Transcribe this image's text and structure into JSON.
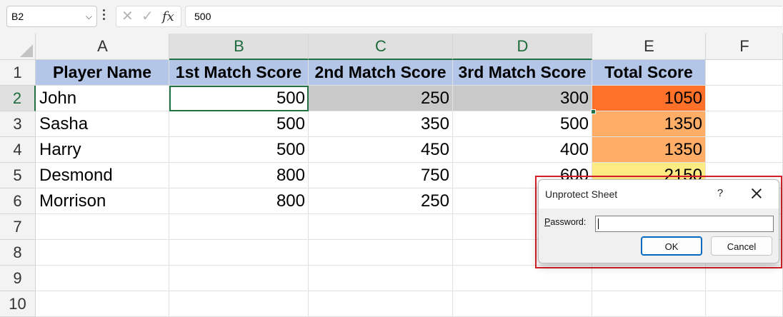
{
  "formula_bar": {
    "name_box": "B2",
    "cancel_symbol": "✕",
    "enter_symbol": "✓",
    "fx_label": "fx",
    "formula_value": "500"
  },
  "columns": [
    "A",
    "B",
    "C",
    "D",
    "E",
    "F"
  ],
  "rows": [
    "1",
    "2",
    "3",
    "4",
    "5",
    "6",
    "7",
    "8",
    "9",
    "10"
  ],
  "table": {
    "headers": [
      "Player Name",
      "1st Match Score",
      "2nd Match Score",
      "3rd Match Score",
      "Total Score"
    ],
    "data": [
      [
        "John",
        "500",
        "250",
        "300",
        "1050"
      ],
      [
        "Sasha",
        "500",
        "350",
        "500",
        "1350"
      ],
      [
        "Harry",
        "500",
        "450",
        "400",
        "1350"
      ],
      [
        "Desmond",
        "800",
        "750",
        "600",
        "2150"
      ],
      [
        "Morrison",
        "800",
        "250",
        "",
        ""
      ]
    ]
  },
  "total_colors": [
    "#ff7128",
    "#ffad67",
    "#ffad67",
    "#ffeb84",
    "#ffffff"
  ],
  "header_fill": "#b4c6e7",
  "selection_color": "#217346",
  "dialog": {
    "title": "Unprotect Sheet",
    "help": "?",
    "password_label_prefix": "P",
    "password_label_rest": "assword:",
    "password_value": "",
    "ok_label": "OK",
    "cancel_label": "Cancel",
    "highlight_color": "#d6202a"
  }
}
